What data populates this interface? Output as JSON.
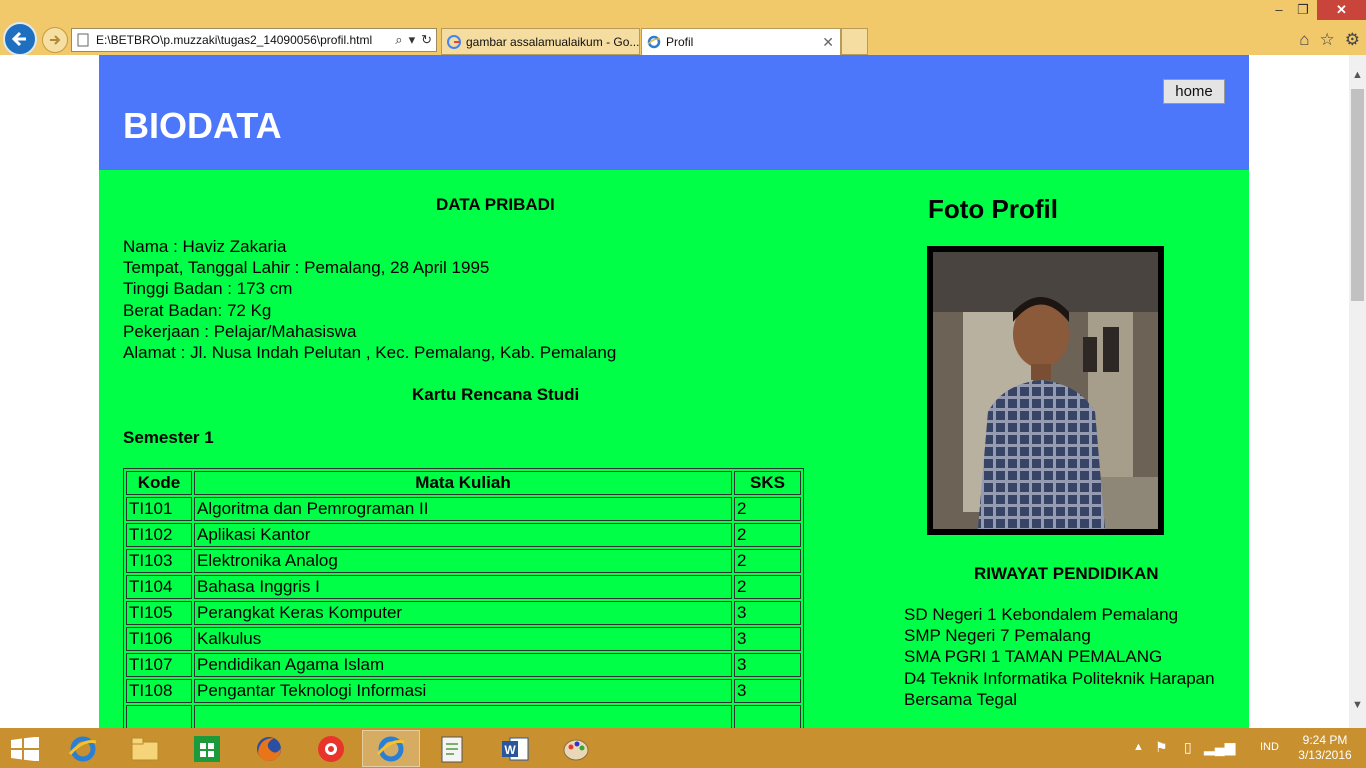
{
  "browser": {
    "address": "E:\\BETBRO\\p.muzzaki\\tugas2_14090056\\profil.html",
    "tabs": [
      {
        "label": "gambar assalamualaikum - Go...",
        "active": false
      },
      {
        "label": "Profil",
        "active": true
      }
    ],
    "window_controls": {
      "minimize": "–",
      "maximize": "❐",
      "close": "✕"
    }
  },
  "header": {
    "title": "BIODATA",
    "home_button": "home",
    "color": "#4d77fa"
  },
  "main": {
    "color": "#00ff47",
    "data_pribadi_title": "DATA PRIBADI",
    "data_pribadi": [
      "Nama : Haviz Zakaria",
      "Tempat, Tanggal Lahir : Pemalang, 28 April 1995",
      "Tinggi Badan : 173 cm",
      "Berat Badan: 72 Kg",
      "Pekerjaan : Pelajar/Mahasiswa",
      "Alamat : Jl. Nusa Indah Pelutan , Kec. Pemalang, Kab. Pemalang"
    ],
    "krs_title": "Kartu Rencana Studi",
    "semester_title": "Semester 1",
    "table": {
      "headers": [
        "Kode",
        "Mata Kuliah",
        "SKS"
      ],
      "rows": [
        [
          "TI101",
          "Algoritma dan Pemrograman II",
          "2"
        ],
        [
          "TI102",
          "Aplikasi Kantor",
          "2"
        ],
        [
          "TI103",
          "Elektronika Analog",
          "2"
        ],
        [
          "TI104",
          "Bahasa Inggris I",
          "2"
        ],
        [
          "TI105",
          "Perangkat Keras Komputer",
          "3"
        ],
        [
          "TI106",
          "Kalkulus",
          "3"
        ],
        [
          "TI107",
          "Pendidikan Agama Islam",
          "3"
        ],
        [
          "TI108",
          "Pengantar Teknologi Informasi",
          "3"
        ]
      ]
    }
  },
  "side": {
    "foto_title": "Foto Profil",
    "riwayat_title": "RIWAYAT PENDIDIKAN",
    "riwayat": [
      "SD Negeri 1 Kebondalem Pemalang",
      "SMP Negeri 7 Pemalang",
      "SMA PGRI 1 TAMAN PEMALANG",
      "D4 Teknik Informatika Politeknik Harapan Bersama Tegal"
    ]
  },
  "taskbar": {
    "apps": [
      "internet-explorer",
      "file-explorer",
      "store",
      "firefox",
      "camera",
      "internet-explorer-active",
      "notepad",
      "word",
      "paint"
    ],
    "tray_language": "IND",
    "time": "9:24 PM",
    "date": "3/13/2016",
    "color": "#c8902e"
  }
}
